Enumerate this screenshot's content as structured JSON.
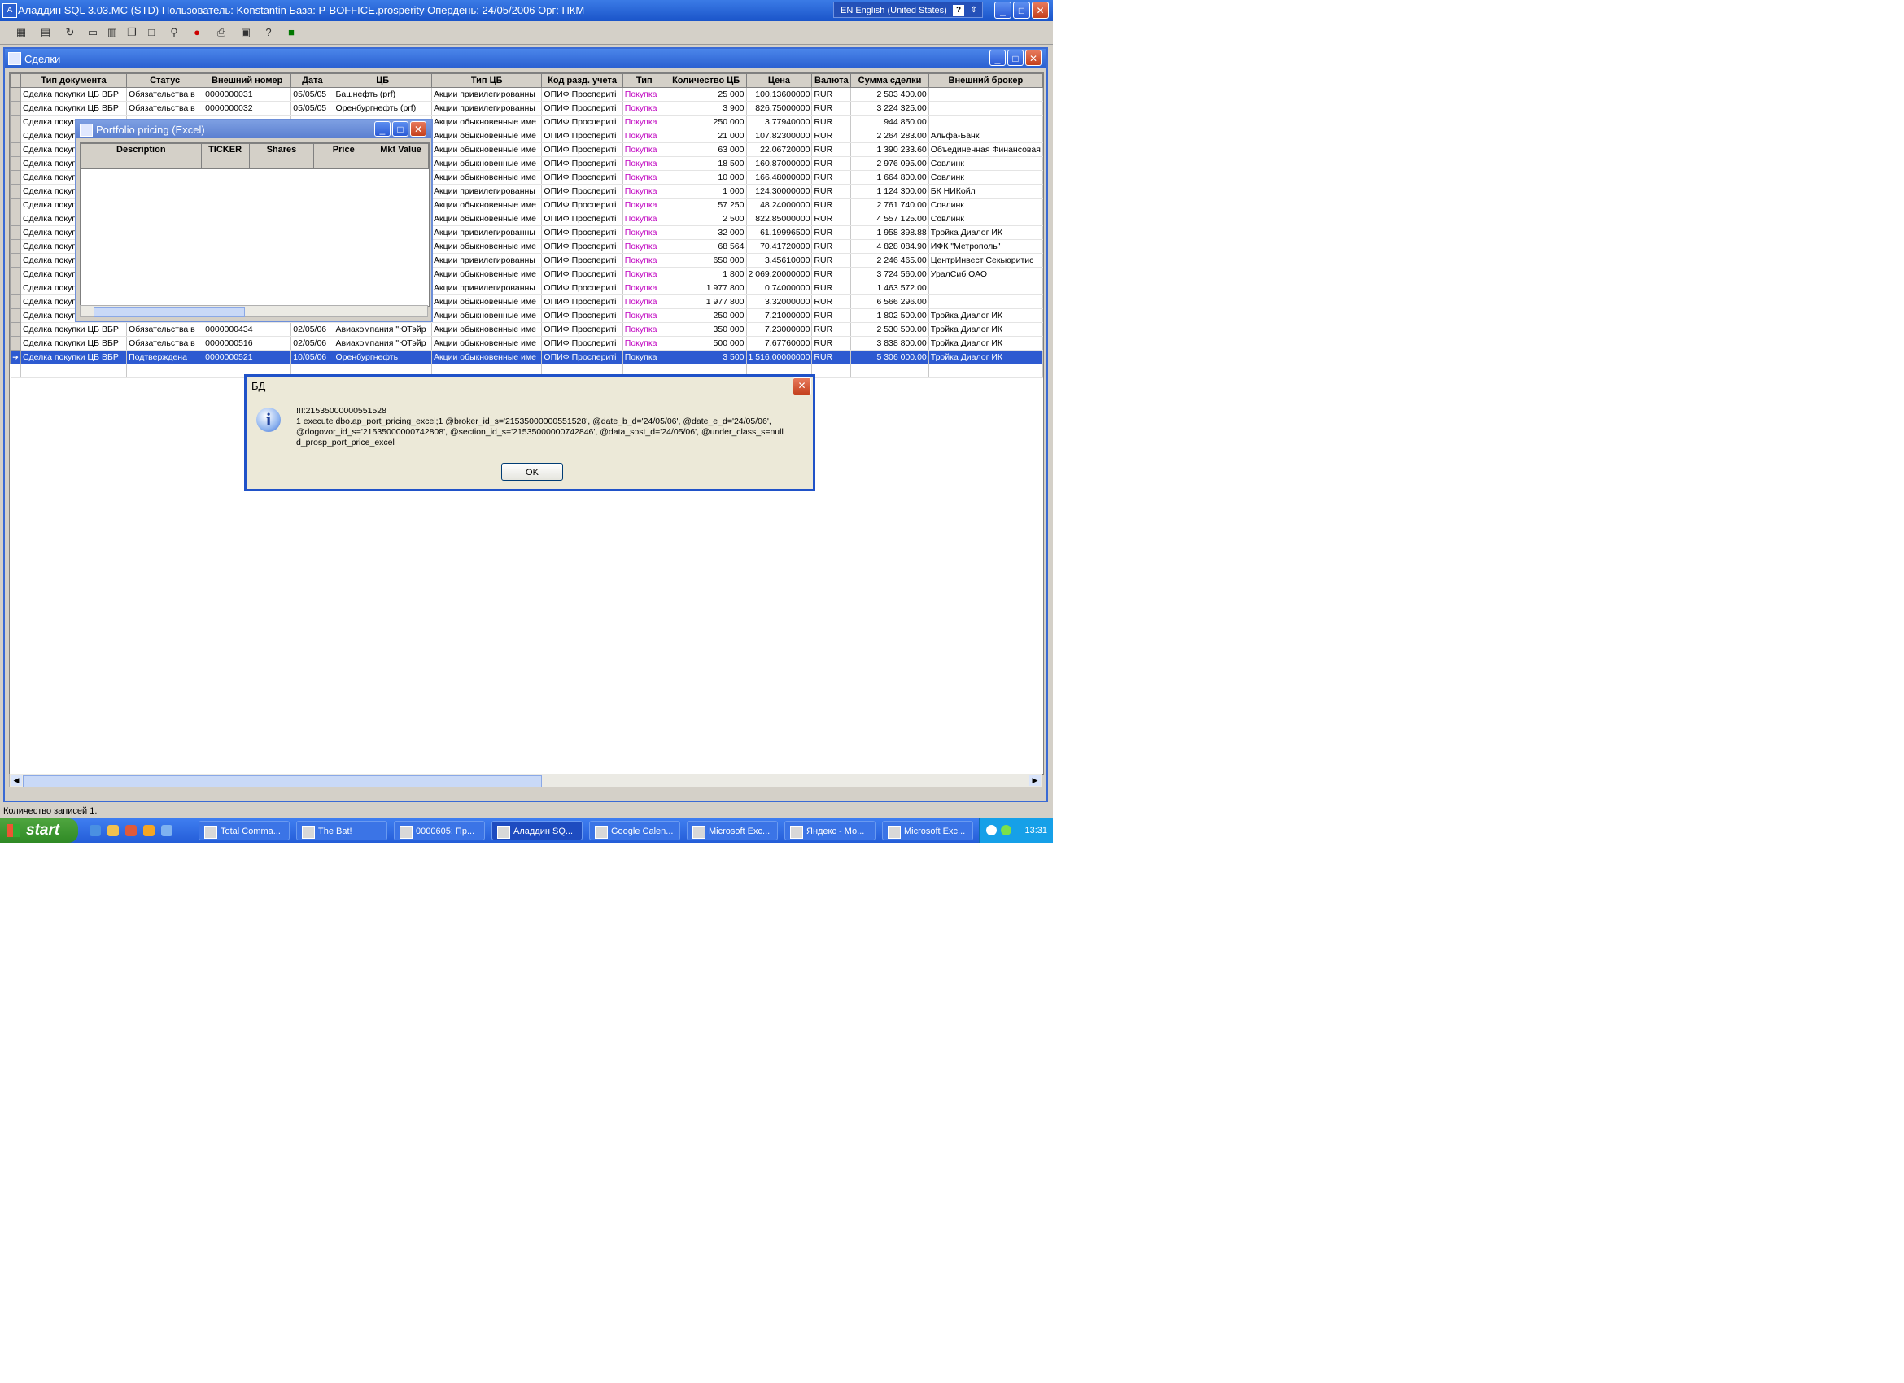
{
  "app": {
    "title": "Аладдин SQL 3.03.MC (STD)  Пользователь: Konstantin База: P-BOFFICE.prosperity Опердень: 24/05/2006 Орг: ПКМ",
    "language": "EN English (United States)"
  },
  "window_controls": {
    "minimize": "_",
    "restore": "□",
    "maximize": "□",
    "close": "✕"
  },
  "toolbar": {
    "icons": [
      "calculator-icon",
      "book-icon",
      "refresh-icon",
      "window-icon",
      "tile-icon",
      "cascade-icon",
      "blank-icon",
      "search-icon",
      "stop-icon",
      "print-icon",
      "export-icon",
      "help-icon",
      "exit-icon"
    ]
  },
  "deals_window": {
    "title": "Сделки",
    "columns": [
      "Тип документа",
      "Статус",
      "Внешний номер",
      "Дата",
      "ЦБ",
      "Тип ЦБ",
      "Код разд. учета",
      "Тип",
      "Количество ЦБ",
      "Цена",
      "Валюта",
      "Сумма сделки",
      "Внешний брокер"
    ],
    "rows": [
      {
        "doc": "Сделка покупки ЦБ ВБР",
        "status": "Обязательства в",
        "ext": "0000000031",
        "date": "05/05/05",
        "sec": "Башнефть (prf)",
        "stype": "Акции привилегированны",
        "code": "ОПИФ Проспериті",
        "type": "Покупка",
        "qty": "25 000",
        "price": "100.13600000",
        "cur": "RUR",
        "sum": "2 503 400.00",
        "broker": ""
      },
      {
        "doc": "Сделка покупки ЦБ ВБР",
        "status": "Обязательства в",
        "ext": "0000000032",
        "date": "05/05/05",
        "sec": "Оренбургнефть (prf)",
        "stype": "Акции привилегированны",
        "code": "ОПИФ Проспериті",
        "type": "Покупка",
        "qty": "3 900",
        "price": "826.75000000",
        "cur": "RUR",
        "sum": "3 224 325.00",
        "broker": ""
      },
      {
        "doc": "Сделка покуп",
        "status": "",
        "ext": "",
        "date": "",
        "sec": "",
        "stype": "Акции обыкновенные име",
        "code": "ОПИФ Проспериті",
        "type": "Покупка",
        "qty": "250 000",
        "price": "3.77940000",
        "cur": "RUR",
        "sum": "944 850.00",
        "broker": ""
      },
      {
        "doc": "Сделка покуп",
        "status": "",
        "ext": "",
        "date": "",
        "sec": "",
        "stype": "Акции обыкновенные име",
        "code": "ОПИФ Проспериті",
        "type": "Покупка",
        "qty": "21 000",
        "price": "107.82300000",
        "cur": "RUR",
        "sum": "2 264 283.00",
        "broker": "Альфа-Банк"
      },
      {
        "doc": "Сделка покуп",
        "status": "",
        "ext": "",
        "date": "",
        "sec": "",
        "stype": "Акции обыкновенные име",
        "code": "ОПИФ Проспериті",
        "type": "Покупка",
        "qty": "63 000",
        "price": "22.06720000",
        "cur": "RUR",
        "sum": "1 390 233.60",
        "broker": "Объединенная Финансовая"
      },
      {
        "doc": "Сделка покуп",
        "status": "",
        "ext": "",
        "date": "",
        "sec": "",
        "stype": "Акции обыкновенные име",
        "code": "ОПИФ Проспериті",
        "type": "Покупка",
        "qty": "18 500",
        "price": "160.87000000",
        "cur": "RUR",
        "sum": "2 976 095.00",
        "broker": "Совлинк"
      },
      {
        "doc": "Сделка покуп",
        "status": "",
        "ext": "",
        "date": "",
        "sec": "",
        "stype": "Акции обыкновенные име",
        "code": "ОПИФ Проспериті",
        "type": "Покупка",
        "qty": "10 000",
        "price": "166.48000000",
        "cur": "RUR",
        "sum": "1 664 800.00",
        "broker": "Совлинк"
      },
      {
        "doc": "Сделка покуп",
        "status": "",
        "ext": "",
        "date": "",
        "sec": "",
        "stype": "Акции привилегированны",
        "code": "ОПИФ Проспериті",
        "type": "Покупка",
        "qty": "1 000",
        "price": "124.30000000",
        "cur": "RUR",
        "sum": "1 124 300.00",
        "broker": "БК НИКойл"
      },
      {
        "doc": "Сделка покуп",
        "status": "",
        "ext": "",
        "date": "",
        "sec": "",
        "stype": "Акции обыкновенные име",
        "code": "ОПИФ Проспериті",
        "type": "Покупка",
        "qty": "57 250",
        "price": "48.24000000",
        "cur": "RUR",
        "sum": "2 761 740.00",
        "broker": "Совлинк"
      },
      {
        "doc": "Сделка покуп",
        "status": "",
        "ext": "",
        "date": "",
        "sec": "",
        "stype": "Акции обыкновенные име",
        "code": "ОПИФ Проспериті",
        "type": "Покупка",
        "qty": "2 500",
        "price": "822.85000000",
        "cur": "RUR",
        "sum": "4 557 125.00",
        "broker": "Совлинк"
      },
      {
        "doc": "Сделка покуп",
        "status": "",
        "ext": "",
        "date": "",
        "sec": "",
        "stype": "Акции привилегированны",
        "code": "ОПИФ Проспериті",
        "type": "Покупка",
        "qty": "32 000",
        "price": "61.19996500",
        "cur": "RUR",
        "sum": "1 958 398.88",
        "broker": "Тройка Диалог ИК"
      },
      {
        "doc": "Сделка покуп",
        "status": "",
        "ext": "",
        "date": "",
        "sec": "",
        "stype": "Акции обыкновенные име",
        "code": "ОПИФ Проспериті",
        "type": "Покупка",
        "qty": "68 564",
        "price": "70.41720000",
        "cur": "RUR",
        "sum": "4 828 084.90",
        "broker": "ИФК \"Метрополь\""
      },
      {
        "doc": "Сделка покуп",
        "status": "",
        "ext": "",
        "date": "",
        "sec": "",
        "stype": "Акции привилегированны",
        "code": "ОПИФ Проспериті",
        "type": "Покупка",
        "qty": "650 000",
        "price": "3.45610000",
        "cur": "RUR",
        "sum": "2 246 465.00",
        "broker": "ЦентрИнвест Секьюритис"
      },
      {
        "doc": "Сделка покуп",
        "status": "",
        "ext": "",
        "date": "",
        "sec": "",
        "stype": "Акции обыкновенные име",
        "code": "ОПИФ Проспериті",
        "type": "Покупка",
        "qty": "1 800",
        "price": "2 069.20000000",
        "cur": "RUR",
        "sum": "3 724 560.00",
        "broker": "УралСиб ОАО"
      },
      {
        "doc": "Сделка покуп",
        "status": "",
        "ext": "",
        "date": "",
        "sec": "",
        "stype": "Акции привилегированны",
        "code": "ОПИФ Проспериті",
        "type": "Покупка",
        "qty": "1 977 800",
        "price": "0.74000000",
        "cur": "RUR",
        "sum": "1 463 572.00",
        "broker": ""
      },
      {
        "doc": "Сделка покуп",
        "status": "",
        "ext": "",
        "date": "",
        "sec": "",
        "stype": "Акции обыкновенные име",
        "code": "ОПИФ Проспериті",
        "type": "Покупка",
        "qty": "1 977 800",
        "price": "3.32000000",
        "cur": "RUR",
        "sum": "6 566 296.00",
        "broker": ""
      },
      {
        "doc": "Сделка покупки ЦБ ВБР",
        "status": "Обязательства в",
        "ext": "0000000434",
        "date": "02/05/06",
        "sec": "Авиакомпания \"ЮТэйр",
        "stype": "Акции обыкновенные име",
        "code": "ОПИФ Проспериті",
        "type": "Покупка",
        "qty": "250 000",
        "price": "7.21000000",
        "cur": "RUR",
        "sum": "1 802 500.00",
        "broker": "Тройка Диалог ИК"
      },
      {
        "doc": "Сделка покупки ЦБ ВБР",
        "status": "Обязательства в",
        "ext": "0000000434",
        "date": "02/05/06",
        "sec": "Авиакомпания \"ЮТэйр",
        "stype": "Акции обыкновенные име",
        "code": "ОПИФ Проспериті",
        "type": "Покупка",
        "qty": "350 000",
        "price": "7.23000000",
        "cur": "RUR",
        "sum": "2 530 500.00",
        "broker": "Тройка Диалог ИК"
      },
      {
        "doc": "Сделка покупки ЦБ ВБР",
        "status": "Обязательства в",
        "ext": "0000000516",
        "date": "02/05/06",
        "sec": "Авиакомпания \"ЮТэйр",
        "stype": "Акции обыкновенные име",
        "code": "ОПИФ Проспериті",
        "type": "Покупка",
        "qty": "500 000",
        "price": "7.67760000",
        "cur": "RUR",
        "sum": "3 838 800.00",
        "broker": "Тройка Диалог ИК"
      },
      {
        "doc": "Сделка покупки ЦБ ВБР",
        "status": "Подтверждена",
        "ext": "0000000521",
        "date": "10/05/06",
        "sec": "Оренбургнефть",
        "stype": "Акции обыкновенные име",
        "code": "ОПИФ Проспериті",
        "type": "Покупка",
        "qty": "3 500",
        "price": "1 516.00000000",
        "cur": "RUR",
        "sum": "5 306 000.00",
        "broker": "Тройка Диалог ИК"
      }
    ],
    "selected_row": 19
  },
  "portfolio_window": {
    "title": "Portfolio pricing (Excel)",
    "columns": [
      "Description",
      "TICKER",
      "Shares",
      "Price",
      "Mkt Value"
    ]
  },
  "dialog": {
    "title": "БД",
    "lines": [
      "!!!:21535000000551528",
      "1 execute dbo.ap_port_pricing_excel;1 @broker_id_s='21535000000551528', @date_b_d='24/05/06', @date_e_d='24/05/06',",
      "@dogovor_id_s='21535000000742808', @section_id_s='21535000000742846', @data_sost_d='24/05/06', @under_class_s=null",
      "d_prosp_port_price_excel"
    ],
    "ok_label": "OK"
  },
  "status_bar": {
    "text": "Количество записей 1."
  },
  "taskbar": {
    "start_label": "start",
    "tasks": [
      "Total Comma...",
      "The Bat!",
      "0000605: Пр...",
      "Аладдин SQ...",
      "Google Calen...",
      "Microsoft Exc...",
      "Яндекс - Мо...",
      "Microsoft Exc..."
    ],
    "active_task": 3,
    "clock": "13:31"
  },
  "colors": {
    "purchase": "#c000c0",
    "selection": "#2d5ad1",
    "title": "#2a5fd0"
  }
}
